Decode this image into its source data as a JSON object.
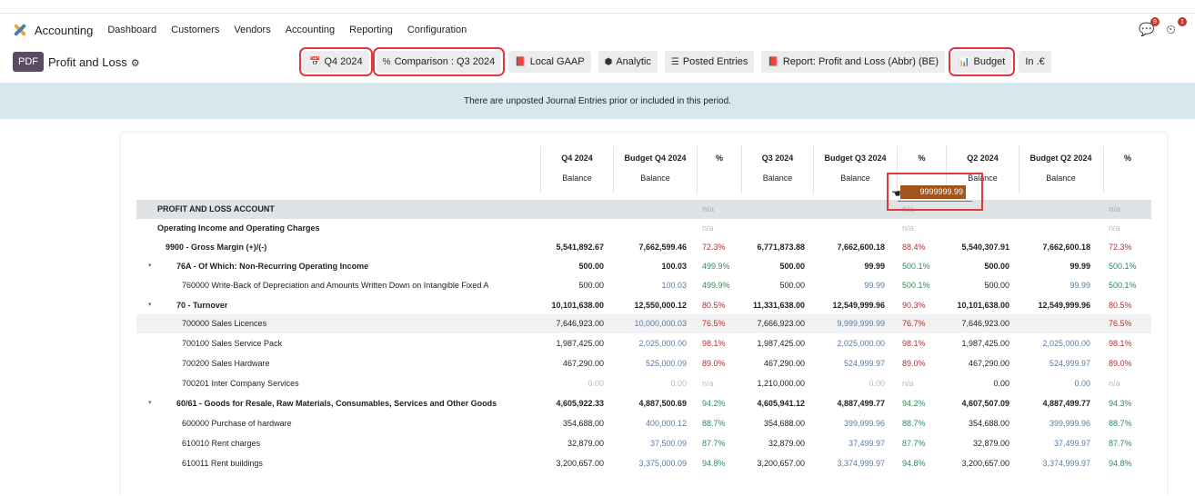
{
  "navbar": {
    "app_name": "Accounting",
    "menu": [
      "Dashboard",
      "Customers",
      "Vendors",
      "Accounting",
      "Reporting",
      "Configuration"
    ],
    "chat_badge": "9",
    "activity_badge": "1"
  },
  "controls": {
    "pdf_label": "PDF",
    "page_title": "Profit and Loss",
    "filters": [
      {
        "icon": "calendar-icon",
        "label": "Q4 2024",
        "highlighted": true
      },
      {
        "icon": "percent-icon",
        "label": "Comparison : Q3 2024",
        "highlighted": true
      },
      {
        "icon": "book-icon",
        "label": "Local GAAP",
        "highlighted": false
      },
      {
        "icon": "stack-icon",
        "label": "Analytic",
        "highlighted": false
      },
      {
        "icon": "sliders-icon",
        "label": "Posted Entries",
        "highlighted": false
      },
      {
        "icon": "book-icon",
        "label": "Report: Profit and Loss (Abbr) (BE)",
        "highlighted": false
      },
      {
        "icon": "bar-chart-icon",
        "label": "Budget",
        "highlighted": true
      },
      {
        "icon": "",
        "label": "In .€",
        "highlighted": false
      }
    ]
  },
  "banner": {
    "prefix": "There are ",
    "link": "unposted Journal Entries",
    "suffix": " prior or included in this period."
  },
  "columns": [
    {
      "title": "Q4 2024",
      "sub": "Balance"
    },
    {
      "title": "Budget Q4 2024",
      "sub": "Balance"
    },
    {
      "title": "%",
      "sub": ""
    },
    {
      "title": "Q3 2024",
      "sub": "Balance"
    },
    {
      "title": "Budget Q3 2024",
      "sub": "Balance"
    },
    {
      "title": "%",
      "sub": ""
    },
    {
      "title": "Q2 2024",
      "sub": "Balance"
    },
    {
      "title": "Budget Q2 2024",
      "sub": "Balance"
    },
    {
      "title": "%",
      "sub": ""
    }
  ],
  "rows": [
    {
      "label": "PROFIT AND LOSS ACCOUNT",
      "level": 0,
      "kind": "section",
      "values": [
        "",
        "",
        "n/a",
        "",
        "",
        "n/a",
        "",
        "",
        "n/a"
      ]
    },
    {
      "label": "Operating Income and Operating Charges",
      "level": 0,
      "kind": "sub",
      "values": [
        "",
        "",
        "n/a",
        "",
        "",
        "n/a",
        "",
        "",
        "n/a"
      ]
    },
    {
      "label": "9900 - Gross Margin (+)/(-)",
      "level": 1,
      "kind": "total",
      "values": [
        "5,541,892.67",
        "7,662,599.46",
        "72.3%",
        "6,771,873.88",
        "7,662,600.18",
        "88.4%",
        "5,540,307.91",
        "7,662,600.18",
        "72.3%"
      ],
      "pct_colors": [
        "red",
        "red",
        "red"
      ]
    },
    {
      "label": "76A - Of Which: Non-Recurring Operating Income",
      "level": 2,
      "kind": "group",
      "values": [
        "500.00",
        "100.03",
        "499.9%",
        "500.00",
        "99.99",
        "500.1%",
        "500.00",
        "99.99",
        "500.1%"
      ],
      "pct_colors": [
        "green",
        "green",
        "green"
      ]
    },
    {
      "label": "760000 Write-Back of Depreciation and Amounts Written Down on Intangible Fixed A",
      "level": 3,
      "kind": "line",
      "values": [
        "500.00",
        "100.03",
        "499.9%",
        "500.00",
        "99.99",
        "500.1%",
        "500.00",
        "99.99",
        "500.1%"
      ],
      "pct_colors": [
        "green",
        "green",
        "green"
      ]
    },
    {
      "label": "70 - Turnover",
      "level": 2,
      "kind": "group",
      "values": [
        "10,101,638.00",
        "12,550,000.12",
        "80.5%",
        "11,331,638.00",
        "12,549,999.96",
        "90.3%",
        "10,101,638.00",
        "12,549,999.96",
        "80.5%"
      ],
      "pct_colors": [
        "red",
        "red",
        "red"
      ]
    },
    {
      "label": "700000 Sales Licences",
      "level": 3,
      "kind": "line",
      "selected": true,
      "values": [
        "7,646,923.00",
        "10,000,000.03",
        "76.5%",
        "7,666,923.00",
        "9,999,999.99",
        "76.7%",
        "7,646,923.00",
        "9999999.99",
        "76.5%"
      ],
      "pct_colors": [
        "red",
        "red",
        "red"
      ]
    },
    {
      "label": "700100 Sales Service Pack",
      "level": 3,
      "kind": "line",
      "values": [
        "1,987,425.00",
        "2,025,000.00",
        "98.1%",
        "1,987,425.00",
        "2,025,000.00",
        "98.1%",
        "1,987,425.00",
        "2,025,000.00",
        "98.1%"
      ],
      "pct_colors": [
        "red",
        "red",
        "red"
      ]
    },
    {
      "label": "700200 Sales Hardware",
      "level": 3,
      "kind": "line",
      "values": [
        "467,290.00",
        "525,000.09",
        "89.0%",
        "467,290.00",
        "524,999.97",
        "89.0%",
        "467,290.00",
        "524,999.97",
        "89.0%"
      ],
      "pct_colors": [
        "red",
        "red",
        "red"
      ]
    },
    {
      "label": "700201 Inter Company Services",
      "level": 3,
      "kind": "line",
      "values": [
        "0.00",
        "0.00",
        "n/a",
        "1,210,000.00",
        "0.00",
        "n/a",
        "0.00",
        "0.00",
        "n/a"
      ],
      "pct_colors": [
        "grey",
        "grey",
        "grey"
      ],
      "grey_cells": [
        0,
        1,
        4
      ]
    },
    {
      "label": "60/61 - Goods for Resale, Raw Materials, Consumables, Services and Other Goods",
      "level": 2,
      "kind": "group",
      "values": [
        "4,605,922.33",
        "4,887,500.69",
        "94.2%",
        "4,605,941.12",
        "4,887,499.77",
        "94.2%",
        "4,607,507.09",
        "4,887,499.77",
        "94.3%"
      ],
      "pct_colors": [
        "green",
        "green",
        "green"
      ]
    },
    {
      "label": "600000 Purchase of hardware",
      "level": 3,
      "kind": "line",
      "values": [
        "354,688.00",
        "400,000.12",
        "88.7%",
        "354,688.00",
        "399,999.96",
        "88.7%",
        "354,688.00",
        "399,999.96",
        "88.7%"
      ],
      "pct_colors": [
        "green",
        "green",
        "green"
      ]
    },
    {
      "label": "610010 Rent charges",
      "level": 3,
      "kind": "line",
      "values": [
        "32,879.00",
        "37,500.09",
        "87.7%",
        "32,879.00",
        "37,499.97",
        "87.7%",
        "32,879.00",
        "37,499.97",
        "87.7%"
      ],
      "pct_colors": [
        "green",
        "green",
        "green"
      ]
    },
    {
      "label": "610011 Rent buildings",
      "level": 3,
      "kind": "line",
      "values": [
        "3,200,657.00",
        "3,375,000.09",
        "94.8%",
        "3,200,657.00",
        "3,374,999.97",
        "94.8%",
        "3,200,657.00",
        "3,374,999.97",
        "94.8%"
      ],
      "pct_colors": [
        "green",
        "green",
        "green"
      ]
    }
  ],
  "editing": {
    "value": "9999999.99"
  }
}
